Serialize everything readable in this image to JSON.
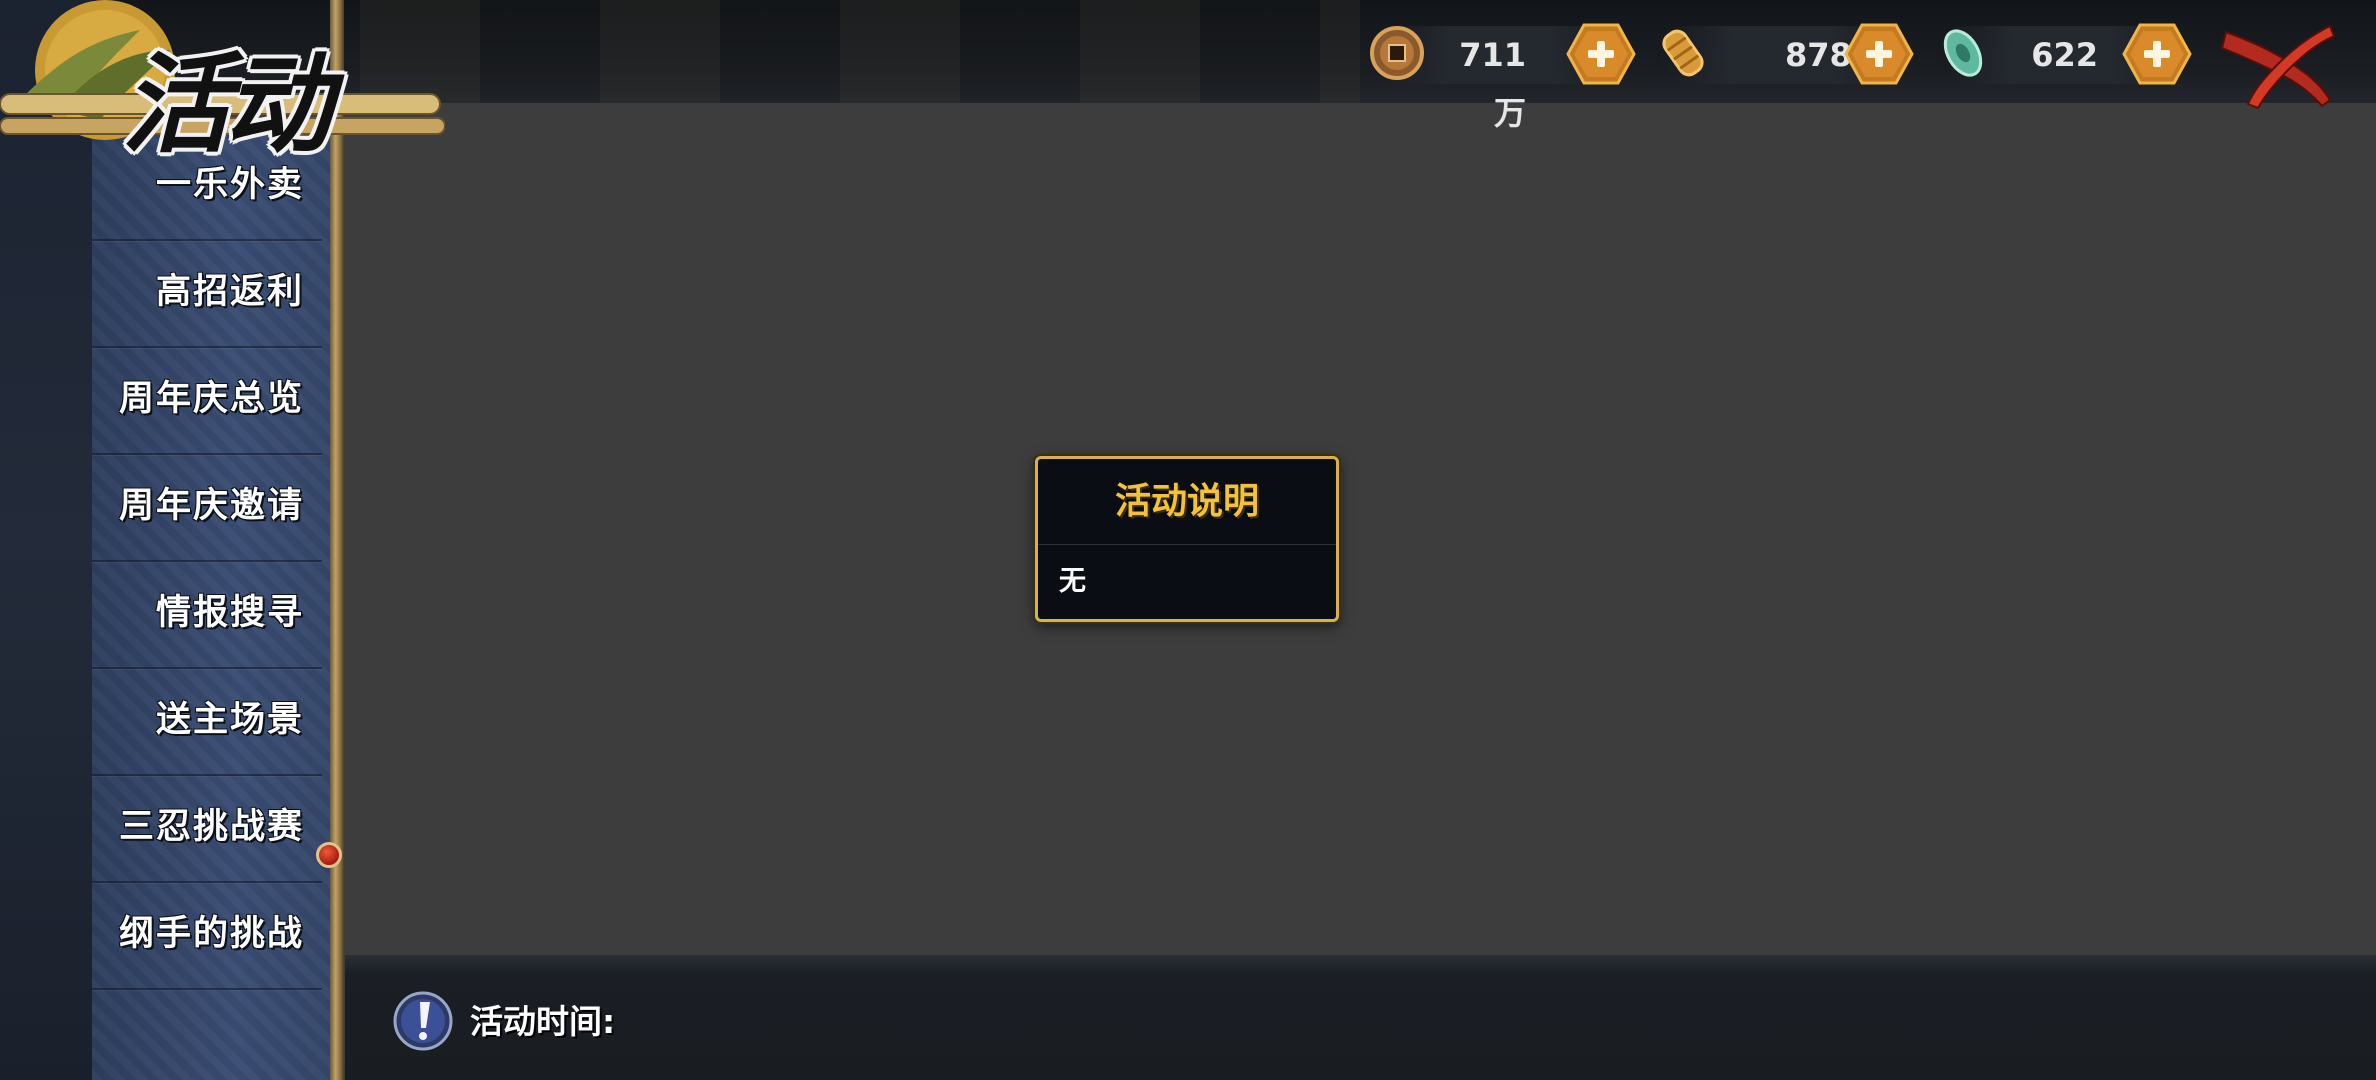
{
  "header": {
    "title": "活动",
    "currencies": [
      {
        "icon": "coin-icon",
        "value": "711万"
      },
      {
        "icon": "scroll-icon",
        "value": "8782"
      },
      {
        "icon": "jade-gem-icon",
        "value": "622"
      }
    ],
    "close_icon": "close-x-icon"
  },
  "sidebar": {
    "items": [
      {
        "label": "一乐外卖"
      },
      {
        "label": "高招返利"
      },
      {
        "label": "周年庆总览"
      },
      {
        "label": "周年庆邀请"
      },
      {
        "label": "情报搜寻"
      },
      {
        "label": "送主场景"
      },
      {
        "label": "三忍挑战赛",
        "has_notification": true
      },
      {
        "label": "纲手的挑战"
      }
    ]
  },
  "dialog": {
    "title": "活动说明",
    "body": "无"
  },
  "footer": {
    "time_label": "活动时间:"
  },
  "colors": {
    "accent_gold": "#d6b14e",
    "dialog_title": "#f2c23a",
    "sidebar_blue": "#3a4d73",
    "notification_red": "#c9281a"
  }
}
